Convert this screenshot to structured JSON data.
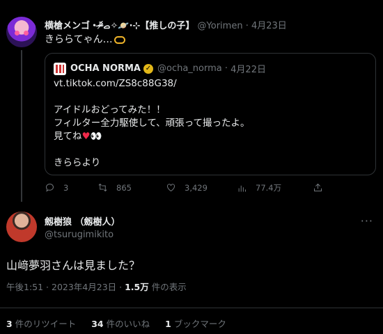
{
  "parent": {
    "display_name": "横槍メンゴ・ᵒ̴̶̷᷄ࡇ✧🪐·⊹【推しの子】",
    "handle": "@Yorimen",
    "date": "4月23日",
    "text": "きららてゃん…"
  },
  "quote": {
    "display_name": "OCHA NORMA",
    "handle": "@ocha_norma",
    "date": "4月22日",
    "link": "vt.tiktok.com/ZS8c88G38/",
    "line1": "アイドルおどってみた！！",
    "line2": "フィルター全力駆使して、頑張って撮ったよ。",
    "line3": "見てね",
    "line4": "きららより"
  },
  "actions": {
    "replies": "3",
    "retweets": "865",
    "likes": "3,429",
    "views": "77.4万"
  },
  "main": {
    "display_name": "劔樹狼 （劔樹人）",
    "handle": "@tsurugimikito",
    "text": "山﨑夢羽さんは見ました？",
    "time": "午後1:51 · 2023年4月23日 · ",
    "view_count": "1.5万",
    "view_label": " 件の表示"
  },
  "stats": {
    "retweets_count": "3",
    "retweets_label": "件のリツイート",
    "likes_count": "34",
    "likes_label": "件のいいね",
    "bookmarks_count": "1",
    "bookmarks_label": "ブックマーク"
  }
}
